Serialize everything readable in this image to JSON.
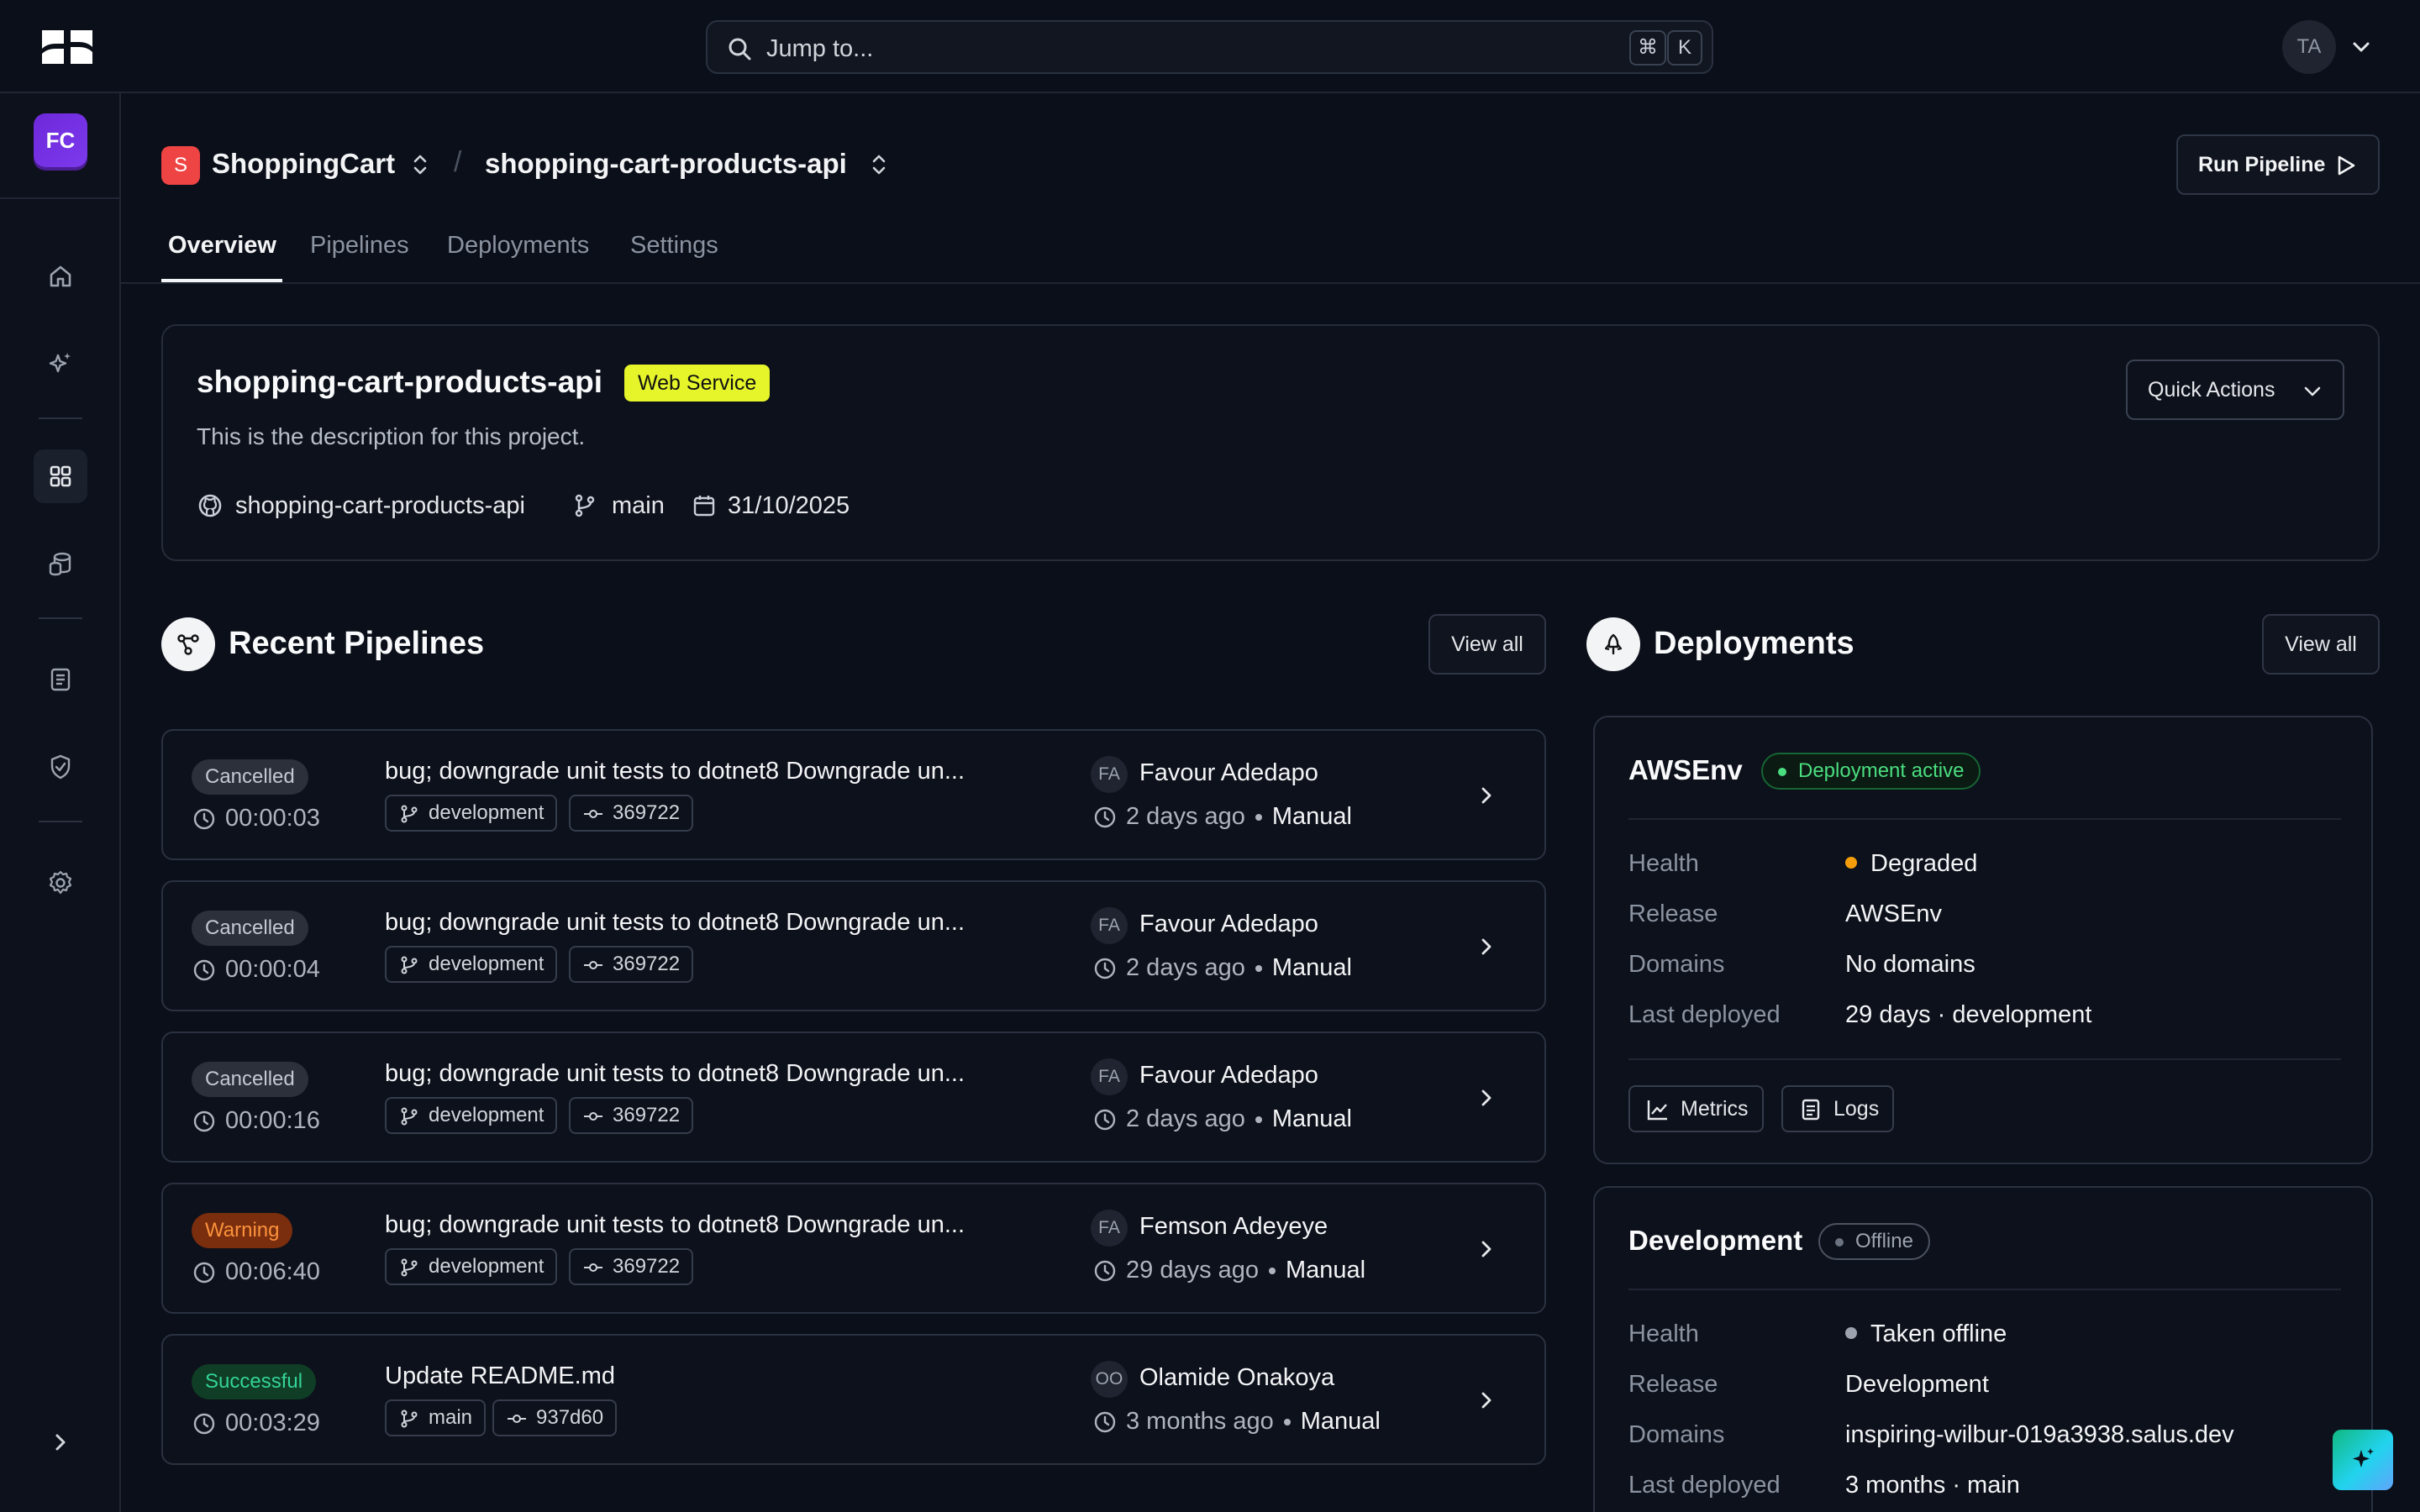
{
  "search": {
    "placeholder": "Jump to...",
    "shortcut_mod": "⌘",
    "shortcut_key": "K"
  },
  "user": {
    "initials": "TA"
  },
  "org": {
    "initials": "FC"
  },
  "breadcrumb": {
    "project_initial": "S",
    "project": "ShoppingCart",
    "separator": "/",
    "service": "shopping-cart-products-api"
  },
  "run_pipeline_label": "Run Pipeline",
  "tabs": [
    {
      "label": "Overview",
      "active": true
    },
    {
      "label": "Pipelines",
      "active": false
    },
    {
      "label": "Deployments",
      "active": false
    },
    {
      "label": "Settings",
      "active": false
    }
  ],
  "project_card": {
    "title": "shopping-cart-products-api",
    "type_badge": "Web Service",
    "description": "This is the description for this project.",
    "repo": "shopping-cart-products-api",
    "branch": "main",
    "date": "31/10/2025",
    "quick_actions_label": "Quick Actions"
  },
  "pipelines_section": {
    "title": "Recent Pipelines",
    "view_all": "View all"
  },
  "pipelines": [
    {
      "status": "Cancelled",
      "status_kind": "cancelled",
      "duration": "00:00:03",
      "message": "bug; downgrade unit tests to dotnet8 Downgrade un...",
      "branch": "development",
      "commit": "369722",
      "avatar": "FA",
      "user": "Favour Adedapo",
      "time": "2 days ago",
      "trigger": "Manual"
    },
    {
      "status": "Cancelled",
      "status_kind": "cancelled",
      "duration": "00:00:04",
      "message": "bug; downgrade unit tests to dotnet8 Downgrade un...",
      "branch": "development",
      "commit": "369722",
      "avatar": "FA",
      "user": "Favour Adedapo",
      "time": "2 days ago",
      "trigger": "Manual"
    },
    {
      "status": "Cancelled",
      "status_kind": "cancelled",
      "duration": "00:00:16",
      "message": "bug; downgrade unit tests to dotnet8 Downgrade un...",
      "branch": "development",
      "commit": "369722",
      "avatar": "FA",
      "user": "Favour Adedapo",
      "time": "2 days ago",
      "trigger": "Manual"
    },
    {
      "status": "Warning",
      "status_kind": "warning",
      "duration": "00:06:40",
      "message": "bug; downgrade unit tests to dotnet8 Downgrade un...",
      "branch": "development",
      "commit": "369722",
      "avatar": "FA",
      "user": "Femson Adeyeye",
      "time": "29 days ago",
      "trigger": "Manual"
    },
    {
      "status": "Successful",
      "status_kind": "success",
      "duration": "00:03:29",
      "message": "Update README.md",
      "branch": "main",
      "commit": "937d60",
      "avatar": "OO",
      "user": "Olamide Onakoya",
      "time": "3 months ago",
      "trigger": "Manual"
    }
  ],
  "deployments_section": {
    "title": "Deployments",
    "view_all": "View all"
  },
  "deployments": [
    {
      "name": "AWSEnv",
      "status": "Deployment active",
      "labels": {
        "health": "Health",
        "release": "Release",
        "domains": "Domains",
        "last_deployed": "Last deployed"
      },
      "health": "Degraded",
      "health_color": "#f59e0b",
      "release": "AWSEnv",
      "domains": "No domains",
      "last_deployed": "29 days · development",
      "metrics_label": "Metrics",
      "logs_label": "Logs"
    },
    {
      "name": "Development",
      "status": "Offline",
      "labels": {
        "health": "Health",
        "release": "Release",
        "domains": "Domains",
        "last_deployed": "Last deployed"
      },
      "health": "Taken offline",
      "health_color": "#9ca3af",
      "release": "Development",
      "domains": "inspiring-wilbur-019a3938.salus.dev",
      "last_deployed": "3 months · main"
    }
  ],
  "colors": {
    "accent_org": "#7c3aed",
    "project_badge": "#ef4444",
    "service_badge": "#e5f52a"
  }
}
